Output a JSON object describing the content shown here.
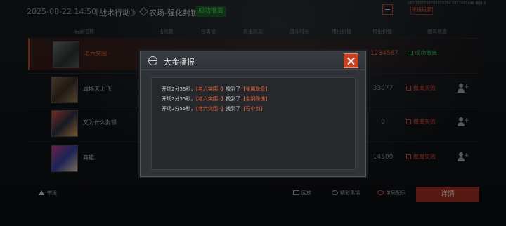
{
  "topbar": {
    "date": "2025-08-22 14:50",
    "sep": "|",
    "mode": "战术行动",
    "arrows": "〉〉",
    "location": "农场-强化封锁",
    "result": "成功撤离",
    "uid_text": "UID:1825798705828254 0923456466 等级:6",
    "report_button": "举报玩家"
  },
  "table_header": [
    "玩家名称",
    "击败数",
    "伤害值",
    "救援队友",
    "战斗时长",
    "带出价值",
    "带出价值",
    "撤离状态"
  ],
  "rows": [
    {
      "name": "老六突围 ·",
      "value": "1234567",
      "status": "成功撤离",
      "self": true
    },
    {
      "name": "局场天上飞",
      "value": "33077",
      "status": "撤离失败",
      "self": false
    },
    {
      "name": "又为什么封锁",
      "value": "0",
      "status": "撤离失败",
      "self": false
    },
    {
      "name": "商能",
      "value": "14500",
      "status": "撤离失败",
      "self": false
    }
  ],
  "bottom": {
    "report": "举报",
    "replay": "回放",
    "clip": "精彩集锦",
    "mark": "单局配乐",
    "details": "详情"
  },
  "modal": {
    "title": "大金播报",
    "messages": [
      {
        "prefix": "开场2分53秒，",
        "player": "【老六突围 ·】",
        "mid": "找到了",
        "item": "【雀翼珠盘】"
      },
      {
        "prefix": "开场2分55秒，",
        "player": "【老六突围 ·】",
        "mid": "找到了",
        "item": "【金钢珠像】"
      },
      {
        "prefix": "开场2分55秒，",
        "player": "【老六突围 ·】",
        "mid": "找到了",
        "item": "【石中剑】"
      }
    ]
  },
  "colors": {
    "accent": "#c8401f",
    "success": "#39c05a",
    "fail": "#d9483a",
    "highlight": "#e0623e"
  }
}
